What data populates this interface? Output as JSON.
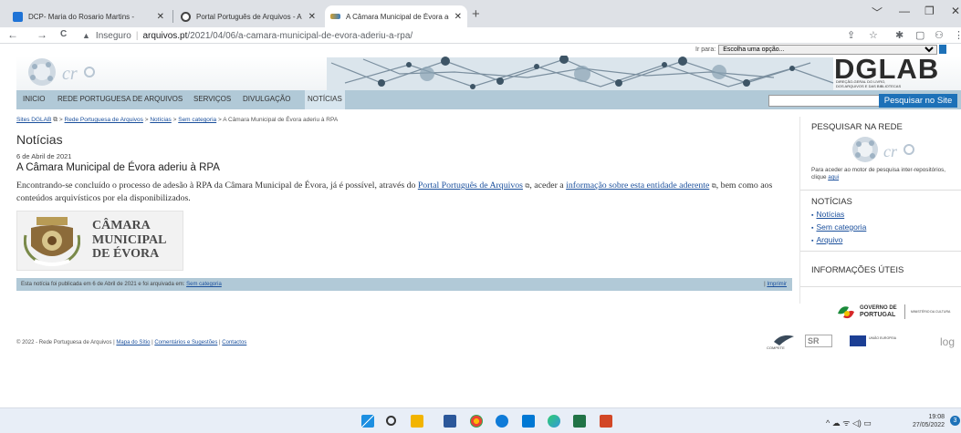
{
  "browser": {
    "tabs": [
      {
        "title": "DCP- Maria do Rosario Martins -",
        "close": "✕",
        "favicon_color": "#1f73d6"
      },
      {
        "title": "Portal Português de Arquivos - A",
        "close": "✕",
        "favicon_color": "#444444"
      },
      {
        "title": "A Câmara Municipal de Évora ad",
        "close": "✕",
        "favicon_color": "#d0a030"
      }
    ],
    "new_tab": "+",
    "window_controls": [
      "﹀",
      "—",
      "❐",
      "✕"
    ],
    "nav": {
      "back": "←",
      "forward": "→",
      "reload": "C"
    },
    "security_label": "Inseguro",
    "url_host": "arquivos.pt",
    "url_path": "/2021/04/06/a-camara-municipal-de-evora-aderiu-a-rpa/",
    "toolbar_icons": [
      "⇪",
      "☆",
      "✱",
      "▢",
      "⚇",
      "⋮"
    ]
  },
  "header": {
    "ir_para_label": "Ir para:",
    "ir_para_selected": "Escolha uma opção...",
    "dglab_title": "DGLAB",
    "dglab_sub1": "DIREÇÃO-GERAL DO LIVRO,",
    "dglab_sub2": "DOS ARQUIVOS E DAS BIBLIOTECAS",
    "menu": [
      "INICIO",
      "REDE PORTUGUESA DE ARQUIVOS",
      "SERVIÇOS",
      "DIVULGAÇÃO",
      "NOTÍCIAS"
    ],
    "active_menu": "NOTÍCIAS",
    "search_button": "Pesquisar no Site",
    "search_value": ""
  },
  "breadcrumb": {
    "items": [
      "Sites DGLAB",
      "Rede Portuguesa de Arquivos",
      "Notícias",
      "Sem categoria"
    ],
    "current": "A Câmara Municipal de Évora aderiu à RPA",
    "sep": ">"
  },
  "main": {
    "section_title": "Notícias",
    "date": "6 de Abril de 2021",
    "post_title": "A Câmara Municipal de Évora aderiu à RPA",
    "body_1": "Encontrando-se concluído o processo de adesão à RPA da Câmara Municipal de Évora, já é possível, através do ",
    "link_1": "Portal Português de Arquivos",
    "body_2": ", aceder a ",
    "link_2": "informação sobre esta entidade aderente",
    "body_3": ", bem como aos conteúdos arquivísticos por ela disponibilizados.",
    "ext_icon": "↗",
    "logo_line1": "CÂMARA",
    "logo_line2": "MUNICIPAL",
    "logo_line3": "DE ÉVORA",
    "footer_meta": "Esta notícia foi publicada em 6 de Abril de 2021 e foi arquivada em: ",
    "footer_category": "Sem categoria",
    "footer_print": "Imprimir"
  },
  "sidebar": {
    "search_heading": "PESQUISAR NA REDE",
    "search_desc": "Para aceder ao motor de pesquisa inter-repositórios, clique ",
    "search_link": "aqui",
    "news_heading": "NOTÍCIAS",
    "news_items": [
      "Notícias",
      "Sem categoria",
      "Arquivo"
    ],
    "info_heading": "INFORMAÇÕES ÚTEIS"
  },
  "footer": {
    "copyright": "© 2022 - Rede Portuguesa de Arquivos | ",
    "links": [
      "Mapa do Sítio",
      "Comentários e Sugestões",
      "Contactos"
    ],
    "gov_text1": "GOVERNO DE",
    "gov_text2": "PORTUGAL",
    "gov_text3": "MINISTÉRIO DA CULTURA",
    "compete": "COMPETE",
    "eu_text": "UNIÃO EUROPEIA",
    "log_text": "log"
  },
  "taskbar": {
    "time": "19:08",
    "date": "27/05/2022",
    "notif_count": "3",
    "tray_icons": "^  ☁  ᯤ  ◁)  ▭"
  }
}
